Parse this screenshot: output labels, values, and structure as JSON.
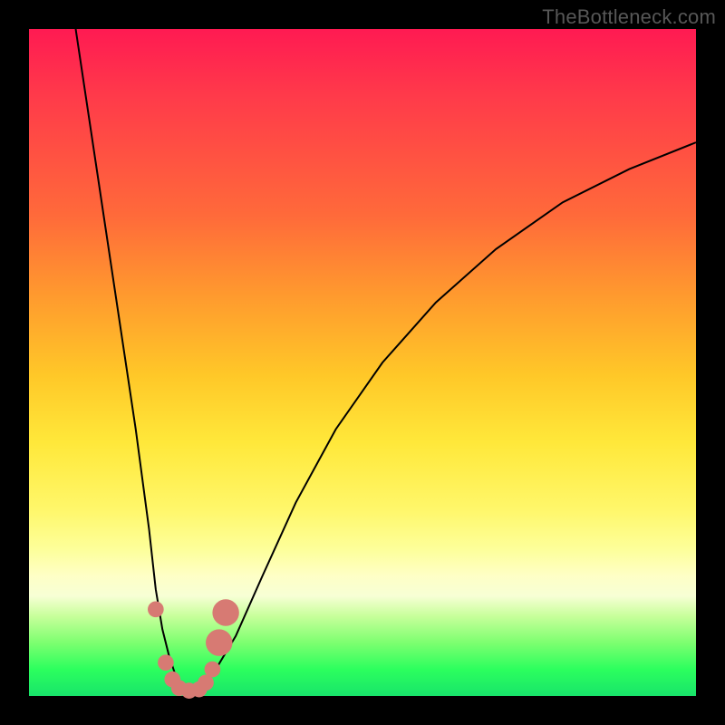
{
  "watermark": "TheBottleneck.com",
  "chart_data": {
    "type": "line",
    "title": "",
    "xlabel": "",
    "ylabel": "",
    "xlim": [
      0,
      100
    ],
    "ylim": [
      0,
      100
    ],
    "series": [
      {
        "name": "bottleneck-curve",
        "x": [
          7,
          10,
          13,
          16,
          18,
          19,
          20,
          21,
          22,
          23,
          24,
          25,
          26,
          28,
          31,
          35,
          40,
          46,
          53,
          61,
          70,
          80,
          90,
          100
        ],
        "values": [
          100,
          80,
          60,
          40,
          25,
          16,
          10,
          6,
          3,
          1,
          0,
          0,
          1,
          4,
          9,
          18,
          29,
          40,
          50,
          59,
          67,
          74,
          79,
          83
        ]
      }
    ],
    "markers": [
      {
        "x": 19.0,
        "y": 13.0,
        "r": 1.2
      },
      {
        "x": 20.5,
        "y": 5.0,
        "r": 1.2
      },
      {
        "x": 21.5,
        "y": 2.5,
        "r": 1.2
      },
      {
        "x": 22.5,
        "y": 1.2,
        "r": 1.2
      },
      {
        "x": 24.0,
        "y": 0.8,
        "r": 1.2
      },
      {
        "x": 25.5,
        "y": 1.0,
        "r": 1.2
      },
      {
        "x": 26.5,
        "y": 2.0,
        "r": 1.2
      },
      {
        "x": 27.5,
        "y": 4.0,
        "r": 1.2
      },
      {
        "x": 28.5,
        "y": 8.0,
        "r": 2.0
      },
      {
        "x": 29.5,
        "y": 12.5,
        "r": 2.0
      }
    ],
    "colors": {
      "curve": "#000000",
      "marker": "#d77a73",
      "gradient_top": "#ff1a52",
      "gradient_bottom": "#18e46a"
    }
  }
}
